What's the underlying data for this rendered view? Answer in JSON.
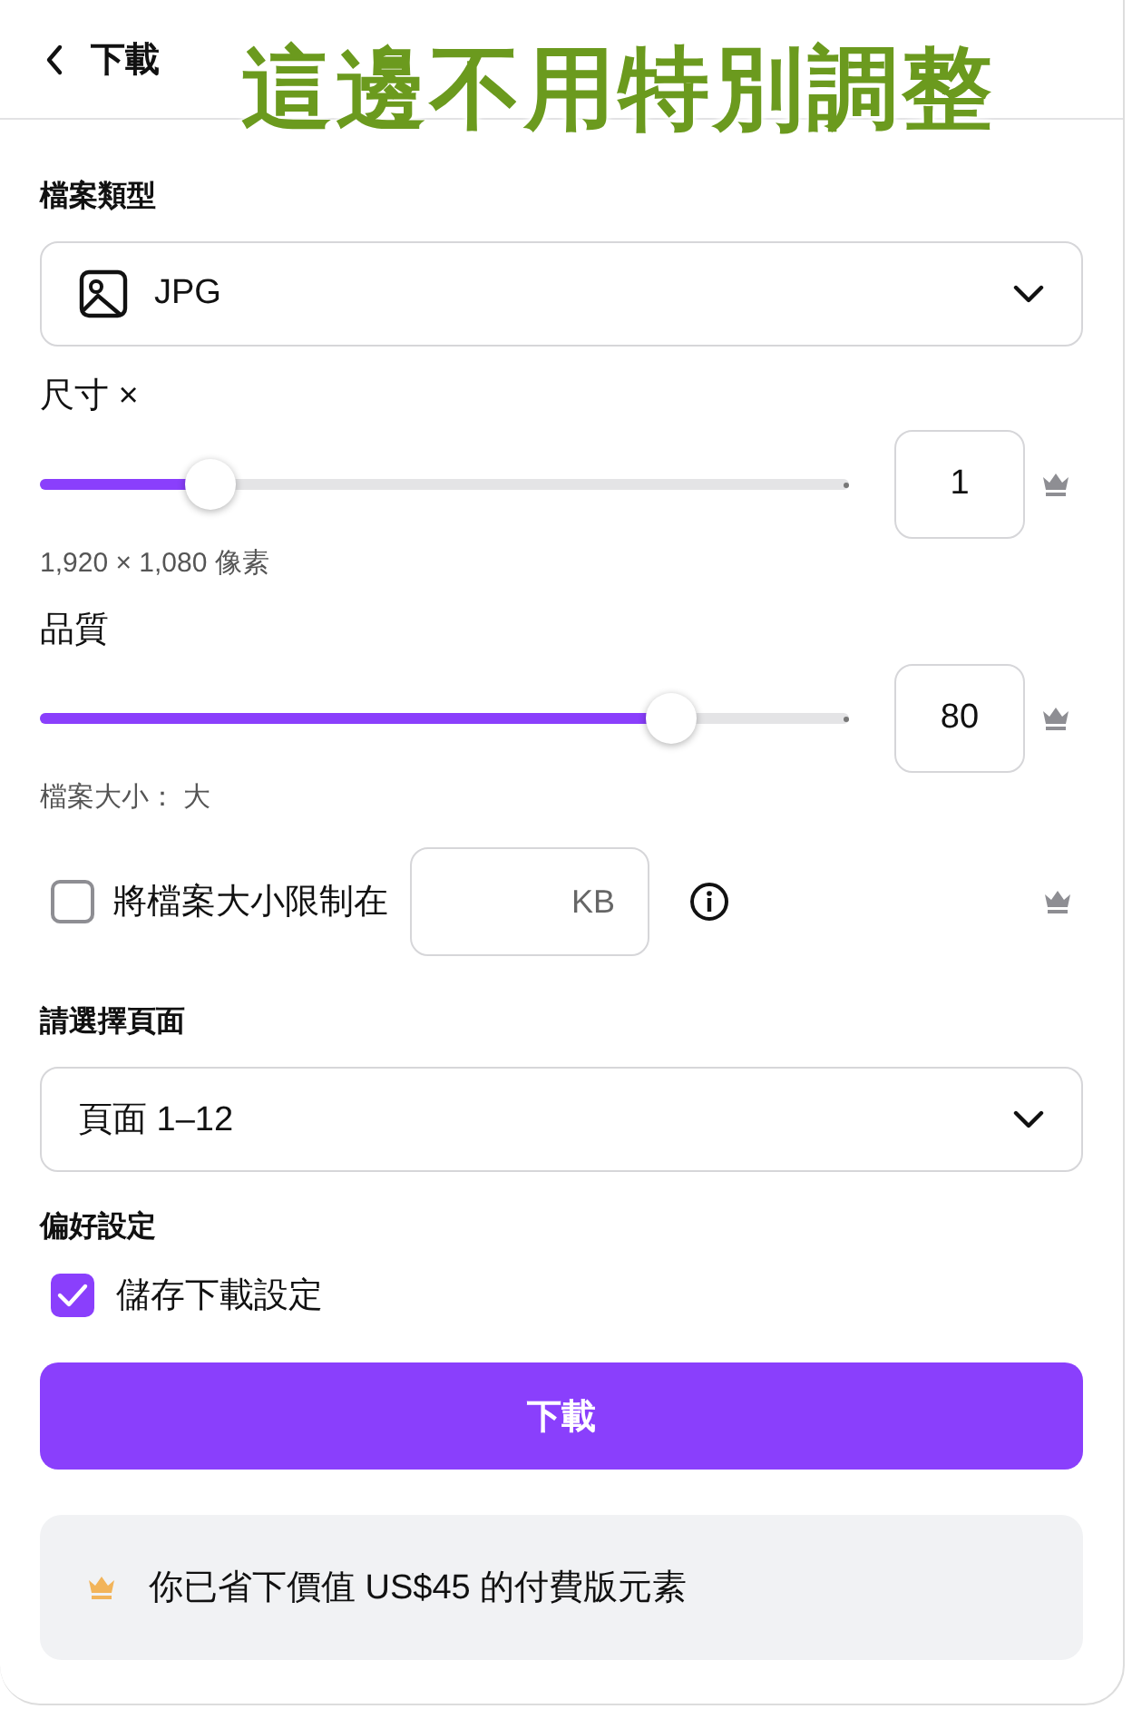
{
  "header": {
    "title": "下載"
  },
  "annotation": {
    "text": "這邊不用特別調整"
  },
  "file_type": {
    "label": "檔案類型",
    "value": "JPG"
  },
  "sliders": [
    {
      "label": "尺寸 ×",
      "level": 0.21,
      "value": "1",
      "note": "1,920 × 1,080 像素"
    },
    {
      "label": "品質",
      "level": 0.78,
      "value": "80",
      "note": "檔案大小： 大"
    }
  ],
  "limit": {
    "label": "將檔案大小限制在",
    "checked": false,
    "unit": "KB"
  },
  "pages": {
    "label": "請選擇頁面",
    "value": "頁面 1–12"
  },
  "preferences": {
    "label": "偏好設定",
    "option": "儲存下載設定",
    "checked": true
  },
  "download_button": "下載",
  "notice": "你已省下價值 US$45 的付費版元素"
}
